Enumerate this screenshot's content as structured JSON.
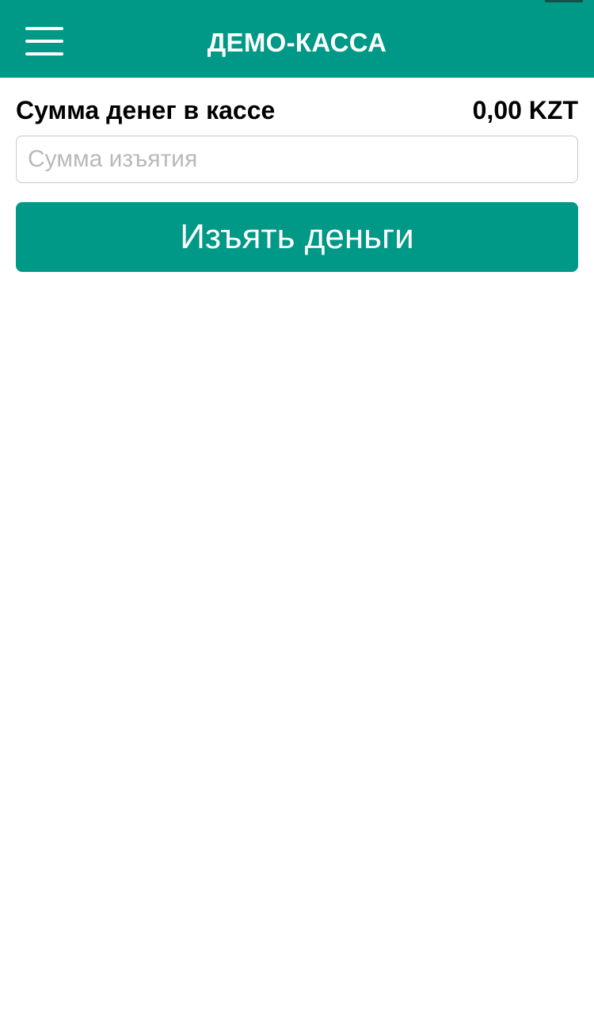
{
  "header": {
    "title": "ДЕМО-КАССА",
    "menu_icon": "hamburger-menu-icon",
    "background_color": "#009886"
  },
  "balance": {
    "label": "Сумма денег в кассе",
    "value": "0,00 KZT"
  },
  "withdraw": {
    "input_value": "",
    "input_placeholder": "Сумма изъятия",
    "button_label": "Изъять деньги"
  },
  "colors": {
    "accent": "#009886",
    "text": "#000000",
    "placeholder": "#b9b9b9",
    "background": "#ffffff"
  }
}
